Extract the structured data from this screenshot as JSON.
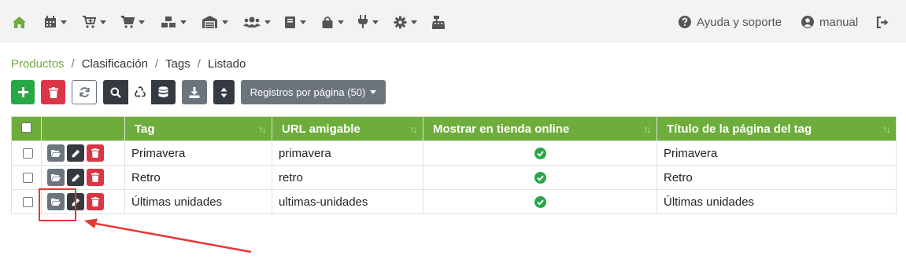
{
  "nav": {
    "icons": [
      "home-icon",
      "calendar-icon",
      "cart-plus-icon",
      "cart-icon",
      "boxes-icon",
      "warehouse-icon",
      "users-icon",
      "book-icon",
      "shopping-bag-icon",
      "plug-icon",
      "cog-icon",
      "cash-register-icon"
    ],
    "help_label": "Ayuda y soporte",
    "user_label": "manual"
  },
  "breadcrumb": {
    "items": [
      "Productos",
      "Clasificación",
      "Tags",
      "Listado"
    ],
    "separator": "/"
  },
  "toolbar": {
    "records_label": "Registros por página (50)"
  },
  "table": {
    "columns": [
      "",
      "",
      "Tag",
      "URL amigable",
      "Mostrar en tienda online",
      "Título de la página del tag"
    ],
    "rows": [
      {
        "tag": "Primavera",
        "url": "primavera",
        "online": true,
        "title": "Primavera"
      },
      {
        "tag": "Retro",
        "url": "retro",
        "online": true,
        "title": "Retro"
      },
      {
        "tag": "Últimas unidades",
        "url": "ultimas-unidades",
        "online": true,
        "title": "Últimas unidades"
      }
    ]
  },
  "colors": {
    "accent": "#6eac3c",
    "header_bar": "#f3f3f3",
    "danger": "#dc3545",
    "success": "#28a745",
    "dark": "#343a40",
    "secondary": "#6c757d",
    "annotation": "#e53935"
  }
}
